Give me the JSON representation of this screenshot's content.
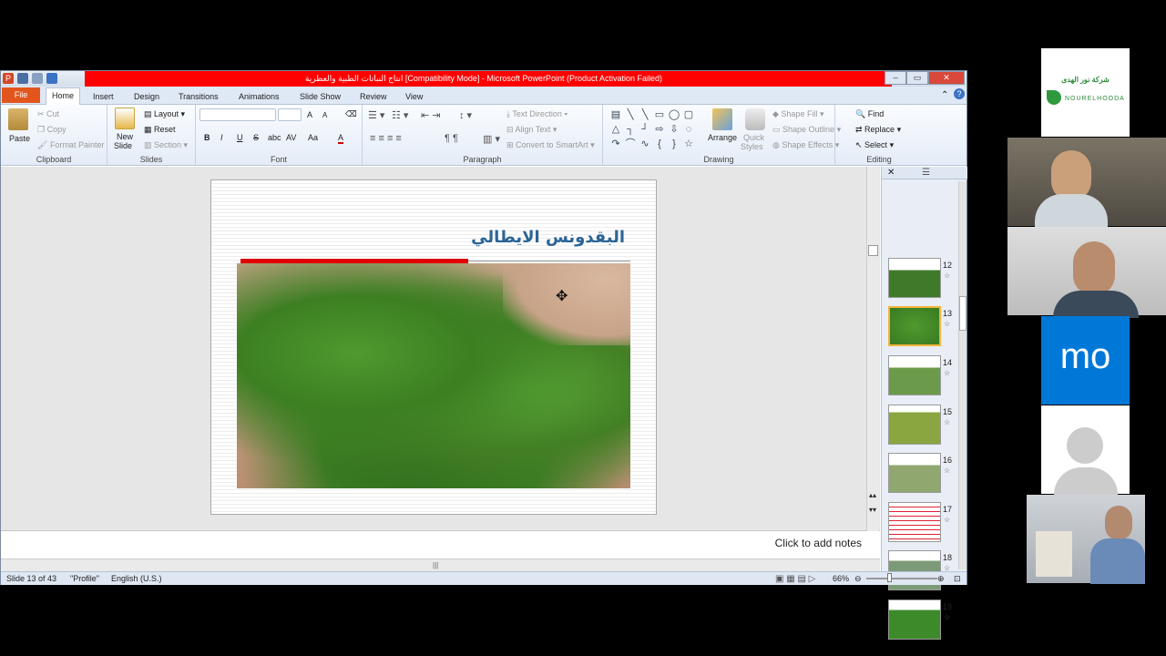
{
  "window": {
    "title": "انتاج النباتات الطبية والعطرية  [Compatibility Mode]  -  Microsoft PowerPoint (Product Activation Failed)"
  },
  "tabs": [
    "File",
    "Home",
    "Insert",
    "Design",
    "Transitions",
    "Animations",
    "Slide Show",
    "Review",
    "View"
  ],
  "ribbon": {
    "clipboard": {
      "paste": "Paste",
      "cut": "Cut",
      "copy": "Copy",
      "format_painter": "Format Painter",
      "label": "Clipboard"
    },
    "slides": {
      "new_slide": "New",
      "new_slide2": "Slide",
      "layout": "Layout",
      "reset": "Reset",
      "section": "Section",
      "label": "Slides"
    },
    "font": {
      "label": "Font",
      "bold": "B",
      "italic": "I",
      "underline": "U",
      "strike": "S",
      "shadow": "abc",
      "spacing": "AV",
      "case": "Aa",
      "color": "A",
      "grow": "A",
      "shrink": "A"
    },
    "paragraph": {
      "label": "Paragraph",
      "text_direction": "Text Direction",
      "align_text": "Align Text",
      "smartart": "Convert to SmartArt"
    },
    "drawing": {
      "label": "Drawing",
      "arrange": "Arrange",
      "quick1": "Quick",
      "quick2": "Styles",
      "shape_fill": "Shape Fill",
      "shape_outline": "Shape Outline",
      "shape_effects": "Shape Effects"
    },
    "editing": {
      "label": "Editing",
      "find": "Find",
      "replace": "Replace",
      "select": "Select"
    }
  },
  "slide": {
    "title": "البقدونس الايطالي"
  },
  "notes": {
    "placeholder": "Click to add notes"
  },
  "thumbnails": [
    {
      "n": "12"
    },
    {
      "n": "13"
    },
    {
      "n": "14"
    },
    {
      "n": "15"
    },
    {
      "n": "16"
    },
    {
      "n": "17"
    },
    {
      "n": "18"
    },
    {
      "n": "19"
    }
  ],
  "status": {
    "slide": "Slide 13 of 43",
    "theme": "\"Profile\"",
    "lang": "English (U.S.)",
    "zoom": "66%"
  },
  "video": {
    "logo_ar": "شركة نور الهدى",
    "logo_en": "NOURELHOODA",
    "tile_text": "mo"
  },
  "colors": {
    "title_red": "#ff0000",
    "file_tab": "#e2561d",
    "accent_blue": "#0078d7",
    "slide_title": "#2b6496"
  }
}
